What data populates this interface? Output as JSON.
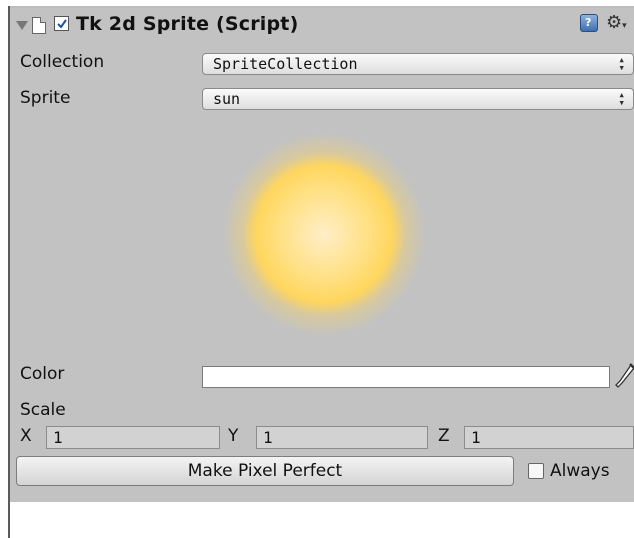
{
  "component": {
    "title": "Tk 2d Sprite (Script)",
    "enabled": true,
    "icons": {
      "foldout": "foldout-arrow-icon",
      "script": "script-doc-icon",
      "help": "help-icon",
      "settings": "gear-icon"
    }
  },
  "fields": {
    "collection_label": "Collection",
    "collection_value": "SpriteCollection",
    "sprite_label": "Sprite",
    "sprite_value": "sun",
    "color_label": "Color",
    "color_value": "#ffffff",
    "scale_label": "Scale",
    "x_label": "X",
    "x_value": "1",
    "y_label": "Y",
    "y_value": "1",
    "z_label": "Z",
    "z_value": "1"
  },
  "actions": {
    "make_pixel_perfect_label": "Make Pixel Perfect",
    "always_label": "Always",
    "always_checked": false
  },
  "colors": {
    "panel": "#c2c2c2",
    "sun_core": "#ffe187"
  }
}
